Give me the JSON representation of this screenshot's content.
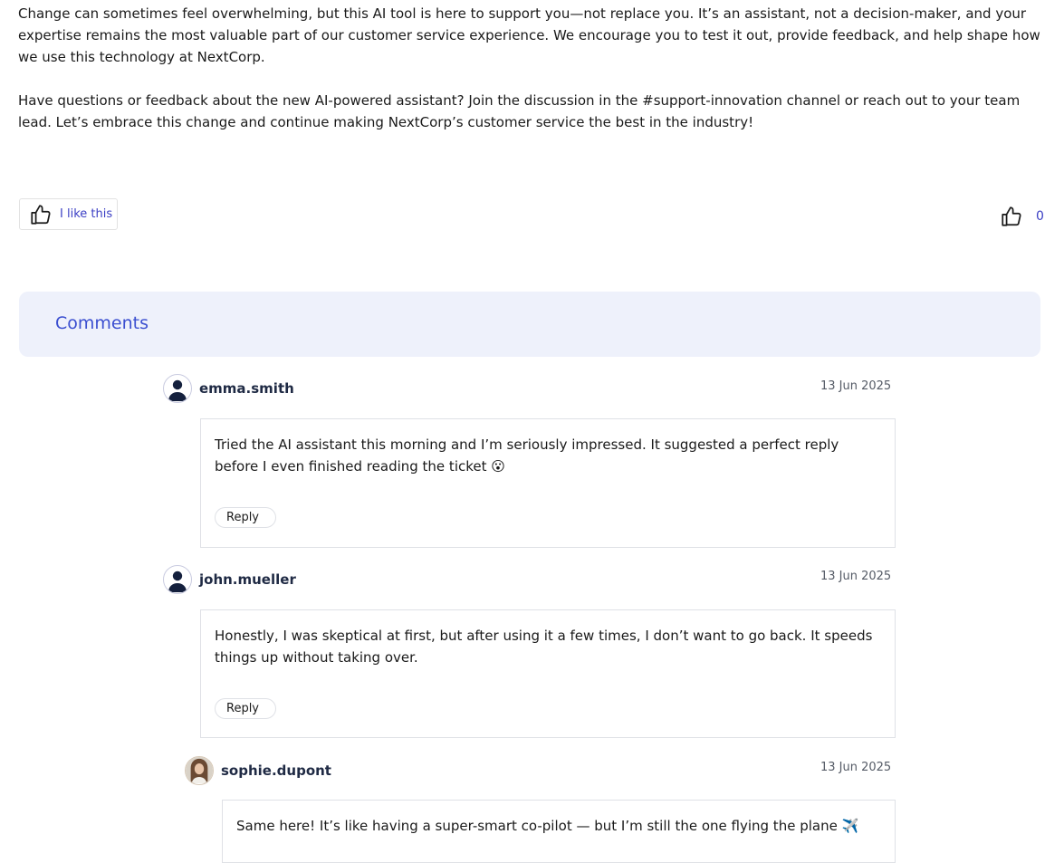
{
  "article": {
    "paragraph1": "Change can sometimes feel overwhelming, but this AI tool is here to support you—not replace you. It’s an assistant, not a decision-maker, and your expertise remains the most valuable part of our customer service experience. We encourage you to test it out, provide feedback, and help shape how we use this technology at NextCorp.",
    "paragraph2": "Have questions or feedback about the new AI-powered assistant? Join the discussion in the #support-innovation channel or reach out to your team lead. Let’s embrace this change and continue making NextCorp’s customer service the best in the industry!"
  },
  "likes": {
    "button_label": "I like this",
    "count": "0"
  },
  "comments": {
    "title": "Comments",
    "items": [
      {
        "username": "emma.smith",
        "date": "13 Jun 2025",
        "text": "Tried the AI assistant this morning and I’m seriously impressed. It suggested a perfect reply before I even finished reading the ticket 😮",
        "reply_label": "Reply"
      },
      {
        "username": "john.mueller",
        "date": "13 Jun 2025",
        "text": "Honestly, I was skeptical at first, but after using it a few times, I don’t want to go back. It speeds things up without taking over.",
        "reply_label": "Reply"
      },
      {
        "username": "sophie.dupont",
        "date": "13 Jun 2025",
        "text": "Same here! It’s like having a super-smart co-pilot — but I’m still the one flying the plane ✈️"
      }
    ]
  },
  "colors": {
    "accent": "#3b3fc4",
    "comments_header_bg": "#eef1fb",
    "comments_title": "#3b4fd0"
  }
}
